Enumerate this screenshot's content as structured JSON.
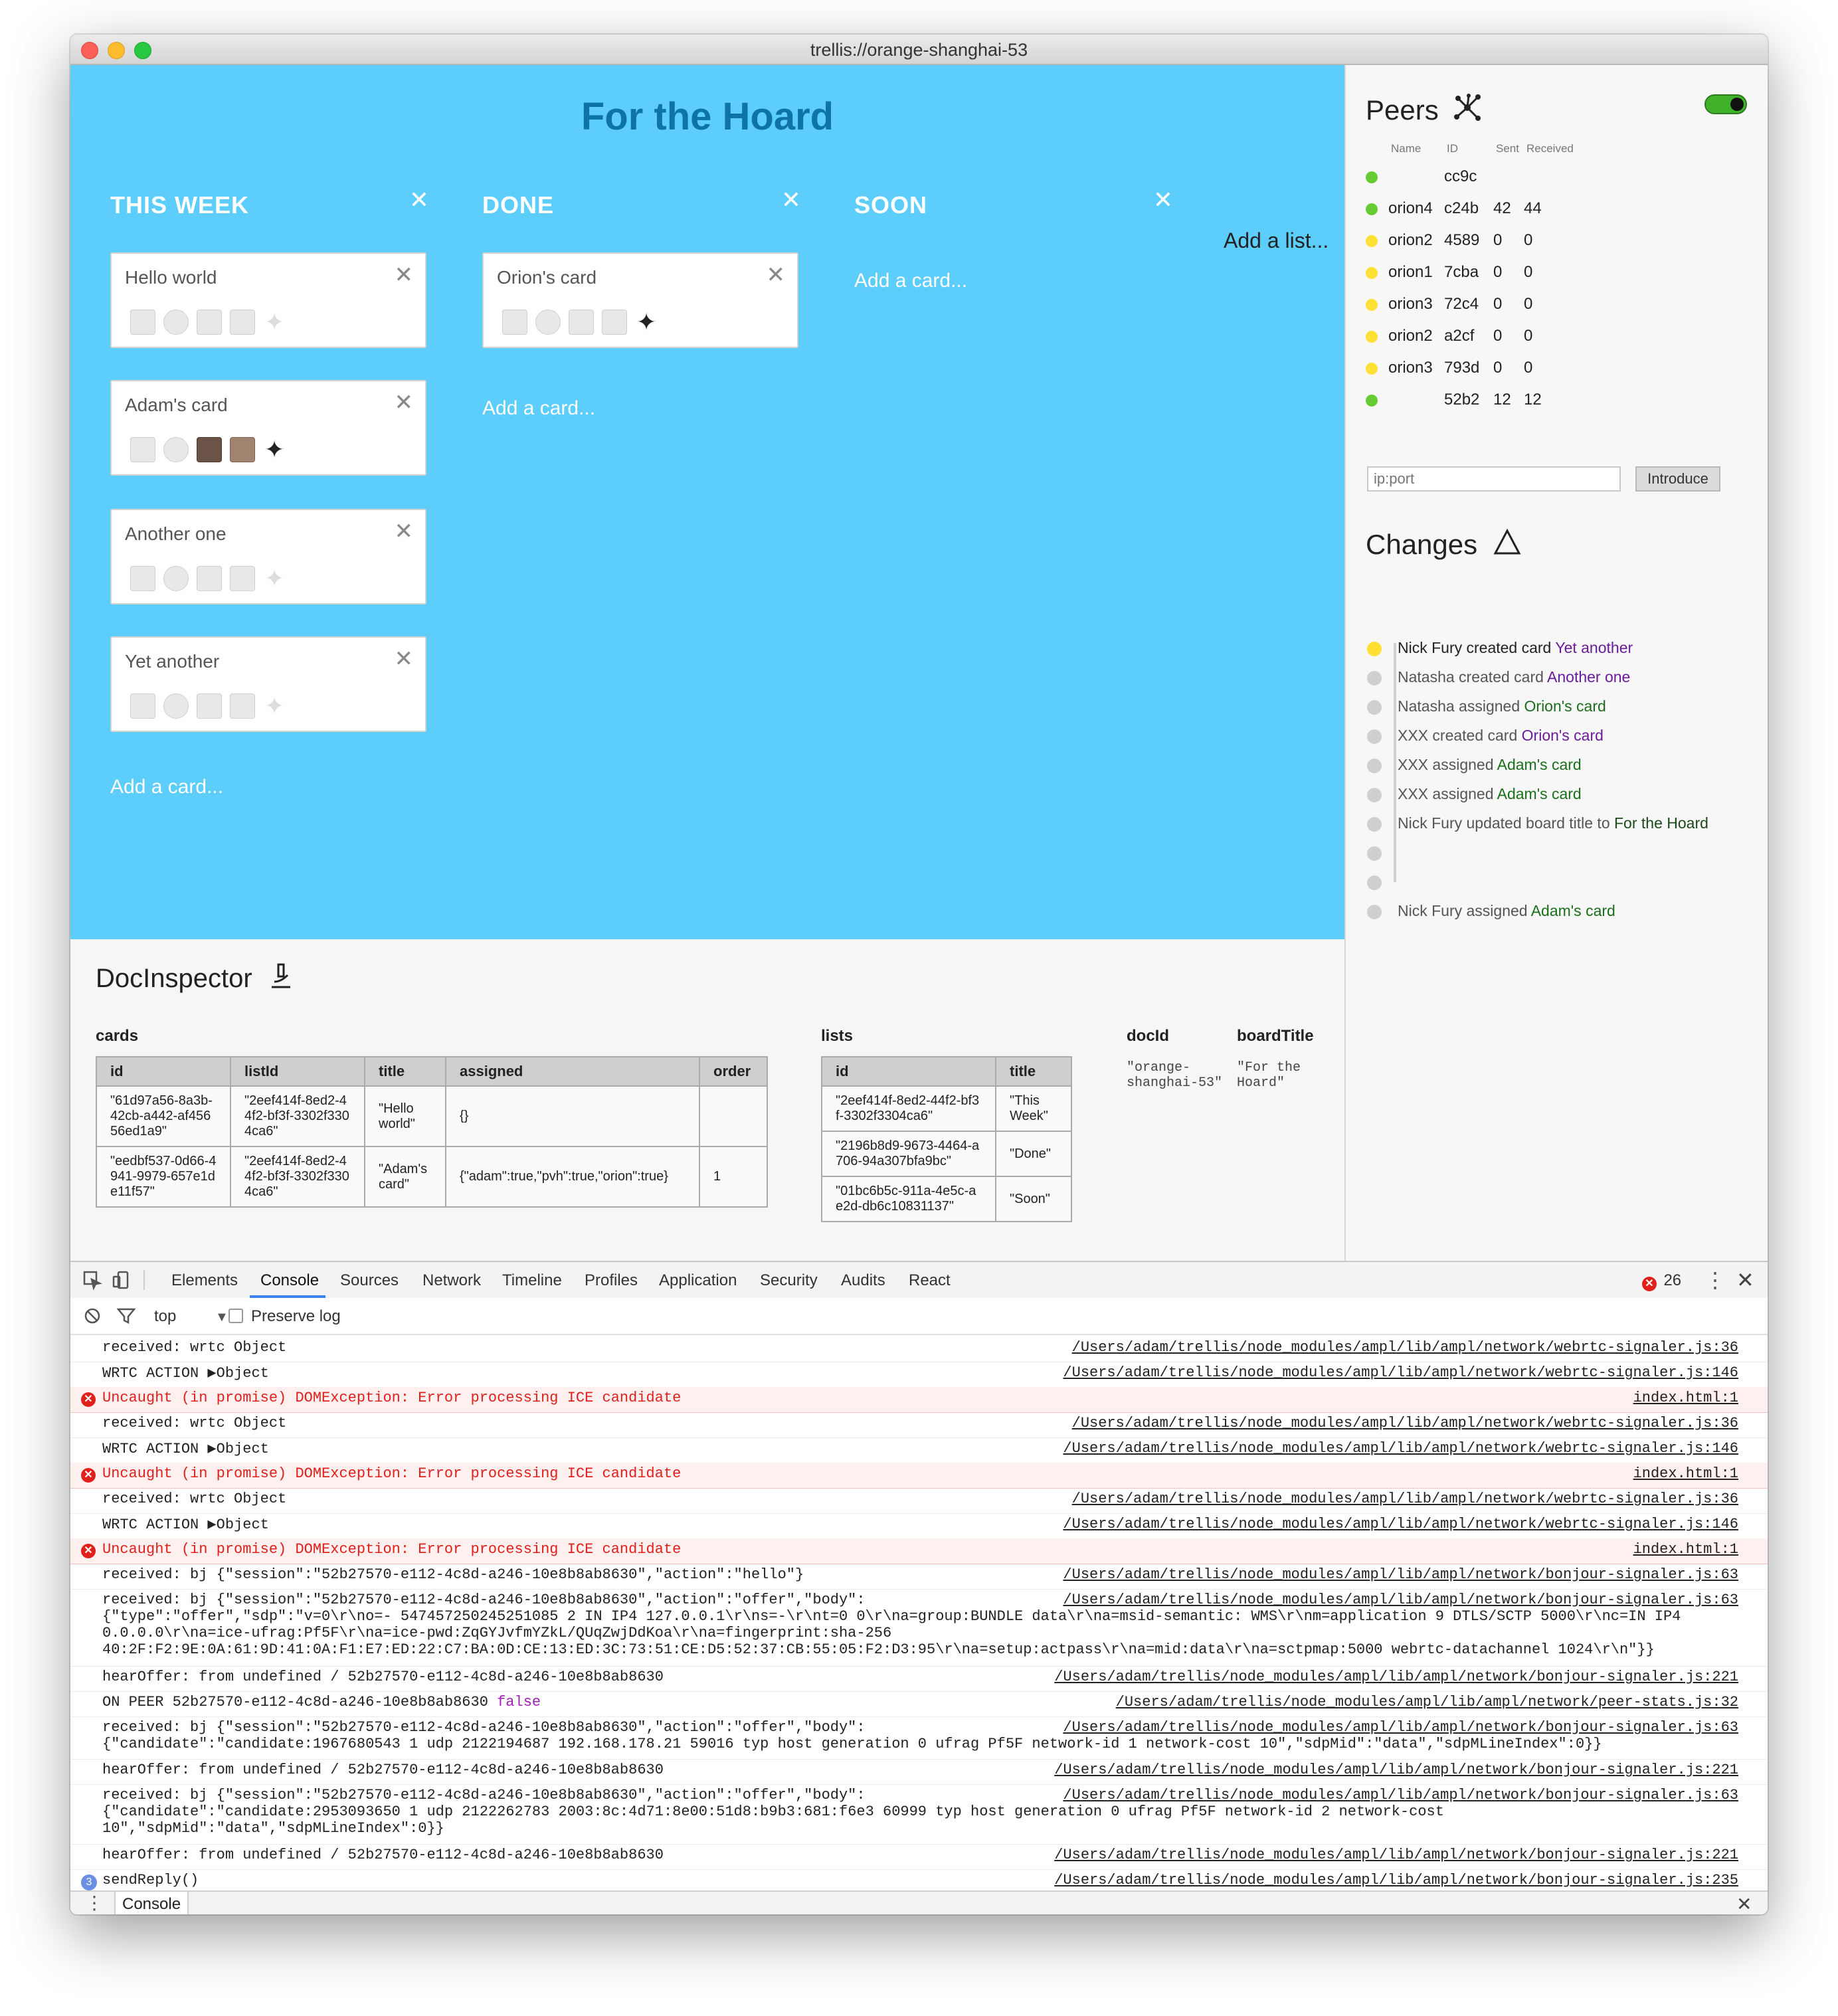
{
  "window": {
    "title": "trellis://orange-shanghai-53"
  },
  "board": {
    "title": "For the Hoard",
    "add_list": "Add a list...",
    "lists": [
      {
        "name": "THIS WEEK",
        "close": "✕",
        "add_card": "Add a card...",
        "cards": [
          {
            "title": "Hello world",
            "assigned": []
          },
          {
            "title": "Adam's card",
            "assigned": [
              "adam",
              "pvh",
              "orion"
            ]
          },
          {
            "title": "Another one",
            "assigned": []
          },
          {
            "title": "Yet another",
            "assigned": []
          }
        ]
      },
      {
        "name": "DONE",
        "close": "✕",
        "add_card": "Add a card...",
        "cards": [
          {
            "title": "Orion's card",
            "assigned": [
              "orion"
            ]
          }
        ]
      },
      {
        "name": "SOON",
        "close": "✕",
        "add_card": "Add a card...",
        "cards": []
      }
    ]
  },
  "peers": {
    "title": "Peers",
    "icon": "network-icon",
    "toggle_on": true,
    "columns": {
      "name": "Name",
      "id": "ID",
      "sent": "Sent",
      "received": "Received"
    },
    "rows": [
      {
        "status": "green",
        "name": "",
        "id": "cc9c",
        "sent": "",
        "received": ""
      },
      {
        "status": "green",
        "name": "orion4",
        "id": "c24b",
        "sent": "42",
        "received": "44"
      },
      {
        "status": "yellow",
        "name": "orion2",
        "id": "4589",
        "sent": "0",
        "received": "0"
      },
      {
        "status": "yellow",
        "name": "orion1",
        "id": "7cba",
        "sent": "0",
        "received": "0"
      },
      {
        "status": "yellow",
        "name": "orion3",
        "id": "72c4",
        "sent": "0",
        "received": "0"
      },
      {
        "status": "yellow",
        "name": "orion2",
        "id": "a2cf",
        "sent": "0",
        "received": "0"
      },
      {
        "status": "yellow",
        "name": "orion3",
        "id": "793d",
        "sent": "0",
        "received": "0"
      },
      {
        "status": "green",
        "name": "",
        "id": "52b2",
        "sent": "12",
        "received": "12"
      }
    ],
    "input_placeholder": "ip:port",
    "introduce_label": "Introduce"
  },
  "changes": {
    "title": "Changes",
    "icon": "delta-icon",
    "items": [
      {
        "text": "Nick Fury created card",
        "ref": "Yet another",
        "active": true
      },
      {
        "text": "Natasha created card",
        "ref": "Another one",
        "active": false
      },
      {
        "text": "Natasha assigned",
        "ref": "Orion's card",
        "active": false
      },
      {
        "text": "XXX created card",
        "ref": "Orion's card",
        "active": false
      },
      {
        "text": "XXX assigned",
        "ref": "Adam's card",
        "active": false
      },
      {
        "text": "XXX assigned",
        "ref": "Adam's card",
        "active": false
      },
      {
        "text": "Nick Fury updated board title to",
        "ref": "For the Hoard",
        "active": false
      },
      {
        "text": "",
        "ref": "",
        "active": false
      },
      {
        "text": "",
        "ref": "",
        "active": false
      },
      {
        "text": "Nick Fury assigned",
        "ref": "Adam's card",
        "active": false
      }
    ]
  },
  "doc_inspector": {
    "title": "DocInspector",
    "icon": "microscope-icon",
    "cards_label": "cards",
    "cards_headers": [
      "id",
      "listId",
      "title",
      "assigned",
      "order"
    ],
    "cards_rows": [
      [
        "\"61d97a56-8a3b-42cb-a442-af45656ed1a9\"",
        "\"2eef414f-8ed2-44f2-bf3f-3302f3304ca6\"",
        "\"Hello world\"",
        "{}",
        ""
      ],
      [
        "\"eedbf537-0d66-4941-9979-657e1de11f57\"",
        "\"2eef414f-8ed2-44f2-bf3f-3302f3304ca6\"",
        "\"Adam's card\"",
        "{\"adam\":true,\"pvh\":true,\"orion\":true}",
        "1"
      ]
    ],
    "lists_label": "lists",
    "lists_headers": [
      "id",
      "title"
    ],
    "lists_rows": [
      [
        "\"2eef414f-8ed2-44f2-bf3f-3302f3304ca6\"",
        "\"This Week\""
      ],
      [
        "\"2196b8d9-9673-4464-a706-94a307bfa9bc\"",
        "\"Done\""
      ],
      [
        "\"01bc6b5c-911a-4e5c-ae2d-db6c10831137\"",
        "\"Soon\""
      ]
    ],
    "docid_label": "docId",
    "docid_value": "\"orange-\nshanghai-53\"",
    "boardtitle_label": "boardTitle",
    "boardtitle_value": "\"For the\nHoard\""
  },
  "devtools": {
    "tabs": [
      "Elements",
      "Console",
      "Sources",
      "Network",
      "Timeline",
      "Profiles",
      "Application",
      "Security",
      "Audits",
      "React"
    ],
    "active_tab": "Console",
    "error_count": "26",
    "context": "top",
    "preserve_log": "Preserve log",
    "drawer_tab": "Console",
    "log": [
      {
        "type": "log",
        "msg": "received: wrtc Object",
        "src": "/Users/adam/trellis/node_modules/ampl/lib/ampl/network/webrtc-signaler.js:36"
      },
      {
        "type": "log",
        "msg": "WRTC ACTION ▶Object",
        "src": "/Users/adam/trellis/node_modules/ampl/lib/ampl/network/webrtc-signaler.js:146"
      },
      {
        "type": "error",
        "msg": "Uncaught (in promise) DOMException: Error processing ICE candidate",
        "src": "index.html:1"
      },
      {
        "type": "log",
        "msg": "received: wrtc Object",
        "src": "/Users/adam/trellis/node_modules/ampl/lib/ampl/network/webrtc-signaler.js:36"
      },
      {
        "type": "log",
        "msg": "WRTC ACTION ▶Object",
        "src": "/Users/adam/trellis/node_modules/ampl/lib/ampl/network/webrtc-signaler.js:146"
      },
      {
        "type": "error",
        "msg": "Uncaught (in promise) DOMException: Error processing ICE candidate",
        "src": "index.html:1"
      },
      {
        "type": "log",
        "msg": "received: wrtc Object",
        "src": "/Users/adam/trellis/node_modules/ampl/lib/ampl/network/webrtc-signaler.js:36"
      },
      {
        "type": "log",
        "msg": "WRTC ACTION ▶Object",
        "src": "/Users/adam/trellis/node_modules/ampl/lib/ampl/network/webrtc-signaler.js:146"
      },
      {
        "type": "error",
        "msg": "Uncaught (in promise) DOMException: Error processing ICE candidate",
        "src": "index.html:1"
      },
      {
        "type": "log",
        "msg": "received: bj {\"session\":\"52b27570-e112-4c8d-a246-10e8b8ab8630\",\"action\":\"hello\"}",
        "src": "/Users/adam/trellis/node_modules/ampl/lib/ampl/network/bonjour-signaler.js:63"
      },
      {
        "type": "log",
        "lines": 4,
        "msg": "received: bj {\"session\":\"52b27570-e112-4c8d-a246-10e8b8ab8630\",\"action\":\"offer\",\"body\":\n{\"type\":\"offer\",\"sdp\":\"v=0\\r\\no=- 547457250245251085 2 IN IP4 127.0.0.1\\r\\ns=-\\r\\nt=0 0\\r\\na=group:BUNDLE data\\r\\na=msid-semantic: WMS\\r\\nm=application 9 DTLS/SCTP 5000\\r\\nc=IN IP4\n0.0.0.0\\r\\na=ice-ufrag:Pf5F\\r\\na=ice-pwd:ZqGYJvfmYZkL/QUqZwjDdKoa\\r\\na=fingerprint:sha-256\n40:2F:F2:9E:0A:61:9D:41:0A:F1:E7:ED:22:C7:BA:0D:CE:13:ED:3C:73:51:CE:D5:52:37:CB:55:05:F2:D3:95\\r\\na=setup:actpass\\r\\na=mid:data\\r\\na=sctpmap:5000 webrtc-datachannel 1024\\r\\n\"}}",
        "src": "/Users/adam/trellis/node_modules/ampl/lib/ampl/network/bonjour-signaler.js:63"
      },
      {
        "type": "log",
        "msg": "hearOffer: from undefined / 52b27570-e112-4c8d-a246-10e8b8ab8630",
        "src": "/Users/adam/trellis/node_modules/ampl/lib/ampl/network/bonjour-signaler.js:221"
      },
      {
        "type": "log",
        "msg": "ON PEER 52b27570-e112-4c8d-a246-10e8b8ab8630",
        "extra": "false",
        "src": "/Users/adam/trellis/node_modules/ampl/lib/ampl/network/peer-stats.js:32"
      },
      {
        "type": "log",
        "lines": 2,
        "msg": "received: bj {\"session\":\"52b27570-e112-4c8d-a246-10e8b8ab8630\",\"action\":\"offer\",\"body\":\n{\"candidate\":\"candidate:1967680543 1 udp 2122194687 192.168.178.21 59016 typ host generation 0 ufrag Pf5F network-id 1 network-cost 10\",\"sdpMid\":\"data\",\"sdpMLineIndex\":0}}",
        "src": "/Users/adam/trellis/node_modules/ampl/lib/ampl/network/bonjour-signaler.js:63"
      },
      {
        "type": "log",
        "msg": "hearOffer: from undefined / 52b27570-e112-4c8d-a246-10e8b8ab8630",
        "src": "/Users/adam/trellis/node_modules/ampl/lib/ampl/network/bonjour-signaler.js:221"
      },
      {
        "type": "log",
        "lines": 3,
        "msg": "received: bj {\"session\":\"52b27570-e112-4c8d-a246-10e8b8ab8630\",\"action\":\"offer\",\"body\":\n{\"candidate\":\"candidate:2953093650 1 udp 2122262783 2003:8c:4d71:8e00:51d8:b9b3:681:f6e3 60999 typ host generation 0 ufrag Pf5F network-id 2 network-cost\n10\",\"sdpMid\":\"data\",\"sdpMLineIndex\":0}}",
        "src": "/Users/adam/trellis/node_modules/ampl/lib/ampl/network/bonjour-signaler.js:63"
      },
      {
        "type": "log",
        "msg": "hearOffer: from undefined / 52b27570-e112-4c8d-a246-10e8b8ab8630",
        "src": "/Users/adam/trellis/node_modules/ampl/lib/ampl/network/bonjour-signaler.js:221"
      },
      {
        "type": "log",
        "badge": "3",
        "msg": "sendReply()",
        "src": "/Users/adam/trellis/node_modules/ampl/lib/ampl/network/bonjour-signaler.js:235"
      }
    ]
  }
}
